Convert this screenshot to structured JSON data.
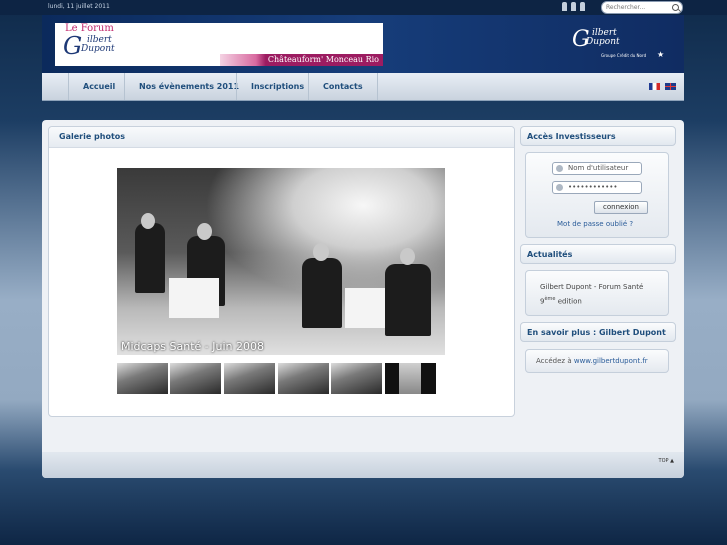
{
  "topbar": {
    "date": "lundi, 11 juillet 2011",
    "search_placeholder": "Rechercher..."
  },
  "banner": {
    "le_forum": "Le Forum",
    "logo_g": "G",
    "logo_gilbert": "ilbert",
    "logo_dupont": "Dupont",
    "venue": "Châteauform' Monceau Rio",
    "right_gilbert": "ilbert",
    "right_dupont": "Dupont",
    "right_sub": "Groupe Crédit du Nord"
  },
  "nav": {
    "items": [
      "Accueil",
      "Nos évènements 2011",
      "Inscriptions",
      "Contacts"
    ]
  },
  "gallery": {
    "title": "Galerie photos",
    "caption": "Midcaps Santé - Juin 2008"
  },
  "investors": {
    "title": "Accès Investisseurs",
    "username_placeholder": "Nom d'utilisateur",
    "password_value": "••••••••••••",
    "login_button": "connexion",
    "forgot": "Mot de passe oublié ?"
  },
  "news": {
    "title": "Actualités",
    "text_main": "Gilbert Dupont - Forum Santé 9",
    "text_sup": "ème",
    "text_end": " edition"
  },
  "more": {
    "title": "En savoir plus : Gilbert Dupont",
    "prefix": "Accédez à ",
    "link": "www.gilbertdupont.fr"
  },
  "footer": {
    "top_link": "TOP ▲"
  }
}
